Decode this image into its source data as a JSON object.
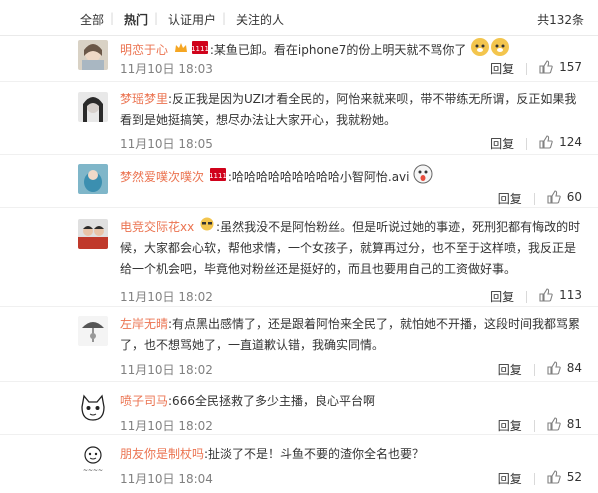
{
  "tabs": {
    "all": "全部",
    "hot": "热门",
    "verified": "认证用户",
    "following": "关注的人",
    "total": "共132条"
  },
  "colors": {
    "username": "#eb7350",
    "time": "#808080",
    "text": "#333333"
  },
  "comments": [
    {
      "user": "明恋于心",
      "text": ":某鱼已卸。看在iphone7的份上明天就不骂你了",
      "time": "11月10日 18:03",
      "reply": "回复",
      "likes": "157"
    },
    {
      "user": "梦瑶梦里",
      "text": ":反正我是因为UZI才看全民的，阿怡来就来呗，带不带练无所谓，反正如果我看到是她挺搞笑，想尽办法让大家开心，我就粉她。",
      "time": "11月10日 18:05",
      "reply": "回复",
      "likes": "124"
    },
    {
      "user": "梦然爱噗次噗次",
      "text": ":哈哈哈哈哈哈哈哈哈小智阿怡.avi",
      "time": "",
      "reply": "回复",
      "likes": "60"
    },
    {
      "user": "电竞交际花xx",
      "text": ":虽然我没不是阿怡粉丝。但是听说过她的事迹，死刑犯都有悔改的时候，大家都会心软，帮他求情，一个女孩子，就算再过分，也不至于这样喷，我反正是给一个机会吧，毕竟他对粉丝还是挺好的，而且也要用自己的工资做好事。",
      "time": "11月10日 18:02",
      "reply": "回复",
      "likes": "113"
    },
    {
      "user": "左岸无晴",
      "text": ":有点黑出感情了，还是跟着阿怡来全民了，就怕她不开播，这段时间我都骂累了，也不想骂她了，一直道歉认错，我确实同情。",
      "time": "11月10日 18:02",
      "reply": "回复",
      "likes": "84"
    },
    {
      "user": "喷子司马",
      "text": ":666全民拯救了多少主播，良心平台啊",
      "time": "11月10日 18:02",
      "reply": "回复",
      "likes": "81"
    },
    {
      "user": "朋友你是制杖吗",
      "text": ":扯淡了不是！斗鱼不要的渣你全名也要？",
      "time": "11月10日 18:04",
      "reply": "回复",
      "likes": "52"
    }
  ]
}
